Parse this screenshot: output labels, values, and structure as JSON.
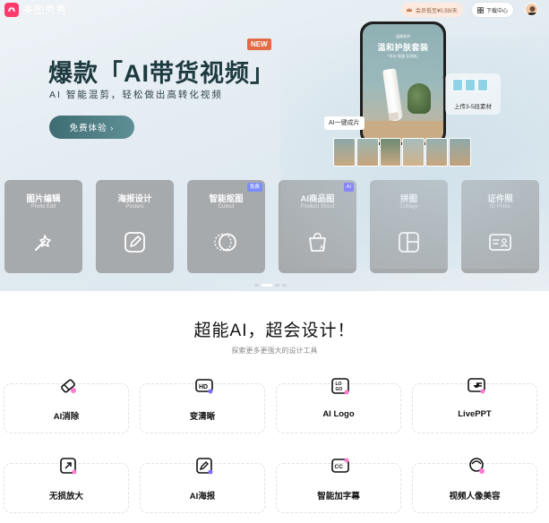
{
  "topbar": {
    "logo_text": "美图秀秀",
    "vip_text": "会员低至¥0.59/天",
    "download_text": "下载中心"
  },
  "hero": {
    "title": "爆款「AI带货视频」",
    "new_badge": "NEW",
    "subtitle": "AI 智能混剪，轻松做出高转化视频",
    "cta_label": "免费体验 ›",
    "phone_small": "温和系列",
    "phone_title": "温和护肤套装",
    "phone_tags": "「补水 保湿 无添加」",
    "upload_text": "上传3-5段素材",
    "ai_chip": "AI一键成片",
    "carousel_count": 4
  },
  "tools": [
    {
      "title": "图片编辑",
      "sub": "Photo Edit",
      "icon": "magic-wand-icon",
      "tag": ""
    },
    {
      "title": "海报设计",
      "sub": "Posters",
      "icon": "poster-pen-icon",
      "tag": ""
    },
    {
      "title": "智能抠图",
      "sub": "Cutout",
      "icon": "cutout-circle-icon",
      "tag": "免费"
    },
    {
      "title": "AI商品图",
      "sub": "Product Shoot",
      "icon": "ai-bag-icon",
      "tag": "AI"
    },
    {
      "title": "拼图",
      "sub": "Collage",
      "icon": "collage-grid-icon",
      "tag": ""
    },
    {
      "title": "证件照",
      "sub": "ID Photo",
      "icon": "id-card-icon",
      "tag": ""
    }
  ],
  "section": {
    "title": "超能AI，超会设计！",
    "subtitle": "探索更多更强大的设计工具"
  },
  "features": [
    {
      "label": "AI消除",
      "icon": "eraser-icon"
    },
    {
      "label": "变清晰",
      "icon": "hd-icon"
    },
    {
      "label": "AI Logo",
      "icon": "logo-icon"
    },
    {
      "label": "LivePPT",
      "icon": "ppt-icon"
    },
    {
      "label": "无损放大",
      "icon": "upscale-icon"
    },
    {
      "label": "AI海报",
      "icon": "ai-poster-icon"
    },
    {
      "label": "智能加字幕",
      "icon": "caption-icon"
    },
    {
      "label": "视频人像美容",
      "icon": "portrait-beauty-icon"
    }
  ],
  "colors": {
    "accent": "#3e6c73",
    "brand": "#ff3b6b",
    "new_badge": "#e46a45",
    "card_bg": "#a7aaad",
    "tag_free": "#7b8cff",
    "tag_ai": "#6a5cff"
  }
}
